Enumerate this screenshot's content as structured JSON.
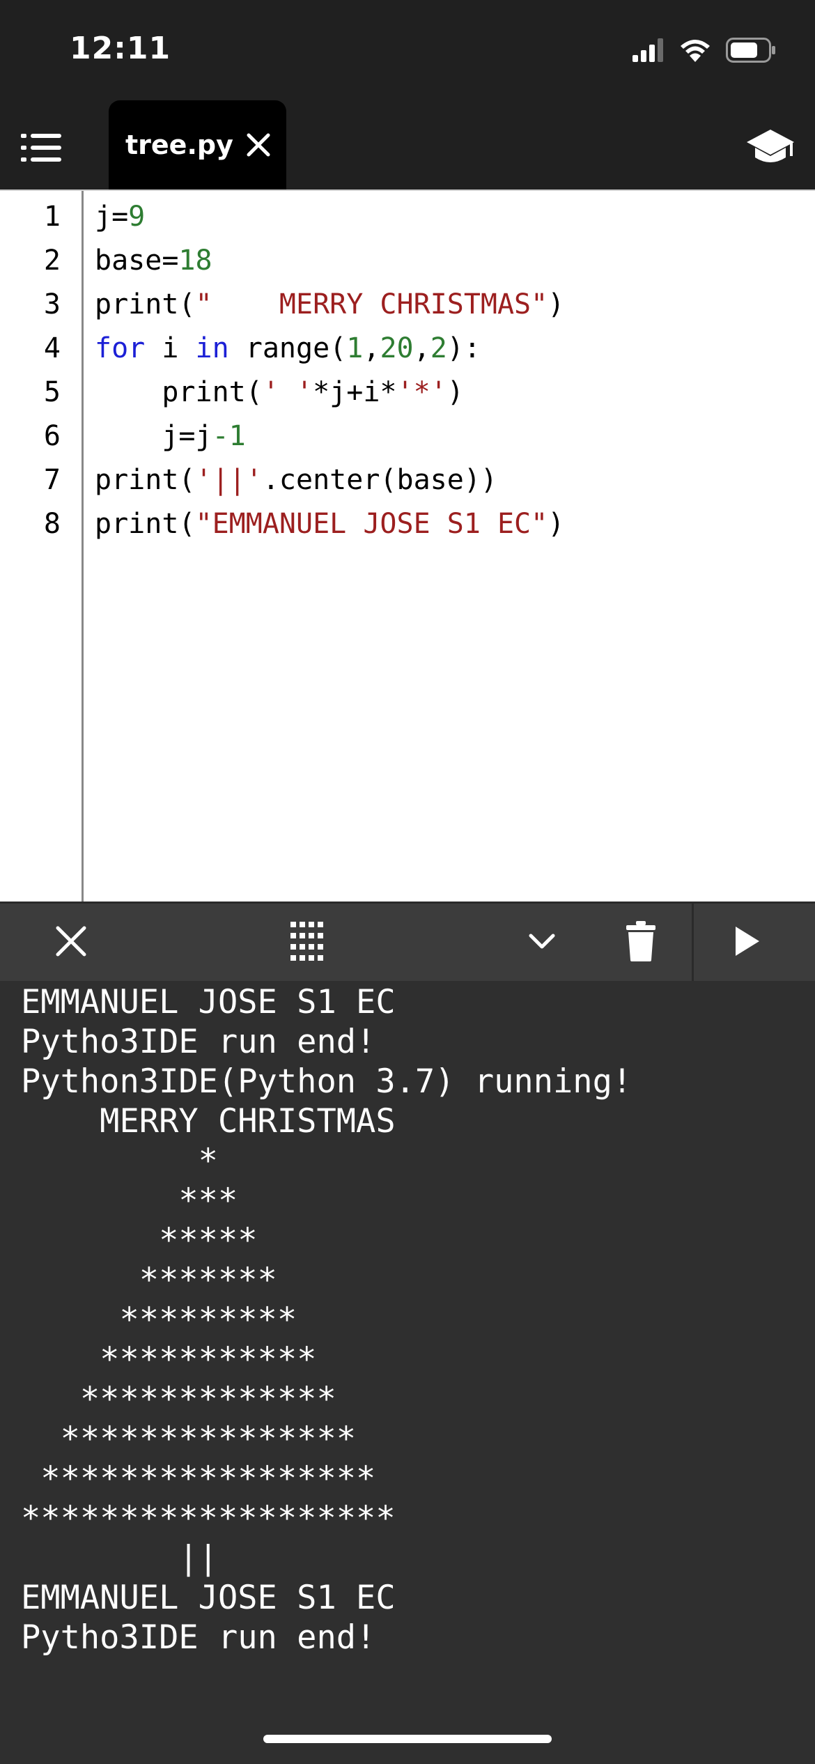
{
  "status_bar": {
    "time": "12:11",
    "icons": [
      "cellular-signal-icon",
      "wifi-icon",
      "battery-icon"
    ]
  },
  "header": {
    "menu_icon": "list-icon",
    "tab": {
      "label": "tree.py",
      "close_icon": "close-icon"
    },
    "learn_icon": "graduation-cap-icon"
  },
  "editor": {
    "line_numbers": [
      "1",
      "2",
      "3",
      "4",
      "5",
      "6",
      "7",
      "8"
    ],
    "lines": [
      [
        [
          "j=",
          "plain"
        ],
        [
          "9",
          "num"
        ]
      ],
      [
        [
          "base=",
          "plain"
        ],
        [
          "18",
          "num"
        ]
      ],
      [
        [
          "print(",
          "plain"
        ],
        [
          "\"    MERRY CHRISTMAS\"",
          "str"
        ],
        [
          ")",
          "plain"
        ]
      ],
      [
        [
          "for",
          "kw"
        ],
        [
          " i ",
          "plain"
        ],
        [
          "in",
          "kw"
        ],
        [
          " range(",
          "plain"
        ],
        [
          "1",
          "num"
        ],
        [
          ",",
          "plain"
        ],
        [
          "20",
          "num"
        ],
        [
          ",",
          "plain"
        ],
        [
          "2",
          "num"
        ],
        [
          "):",
          "plain"
        ]
      ],
      [
        [
          "    print(",
          "plain"
        ],
        [
          "' '",
          "str"
        ],
        [
          "*j+i*",
          "plain"
        ],
        [
          "'*'",
          "str"
        ],
        [
          ")",
          "plain"
        ]
      ],
      [
        [
          "    j=j",
          "plain"
        ],
        [
          "-1",
          "num"
        ]
      ],
      [
        [
          "print(",
          "plain"
        ],
        [
          "'||'",
          "str"
        ],
        [
          ".center(base))",
          "plain"
        ]
      ],
      [
        [
          "print(",
          "plain"
        ],
        [
          "\"EMMANUEL JOSE S1 EC\"",
          "str"
        ],
        [
          ")",
          "plain"
        ]
      ]
    ]
  },
  "console_toolbar": {
    "buttons": [
      "close-icon",
      "keyboard-grid-icon",
      "chevron-down-icon",
      "trash-icon",
      "play-icon"
    ]
  },
  "console": {
    "lines": [
      "EMMANUEL JOSE S1 EC",
      "Pytho3IDE run end!",
      "Python3IDE(Python 3.7) running!",
      "    MERRY CHRISTMAS",
      "         *",
      "        ***",
      "       *****",
      "      *******",
      "     *********",
      "    ***********",
      "   *************",
      "  ***************",
      " *****************",
      "*******************",
      "        ||",
      "EMMANUEL JOSE S1 EC",
      "Pytho3IDE run end!"
    ]
  },
  "colors": {
    "chrome_dark": "#202020",
    "tab_active": "#000000",
    "console_bg": "#2f2f2f",
    "toolbar_bg": "#3c3c3c",
    "syntax_number": "#2e7d32",
    "syntax_string": "#9c1f1f",
    "syntax_keyword": "#1c20d6"
  }
}
